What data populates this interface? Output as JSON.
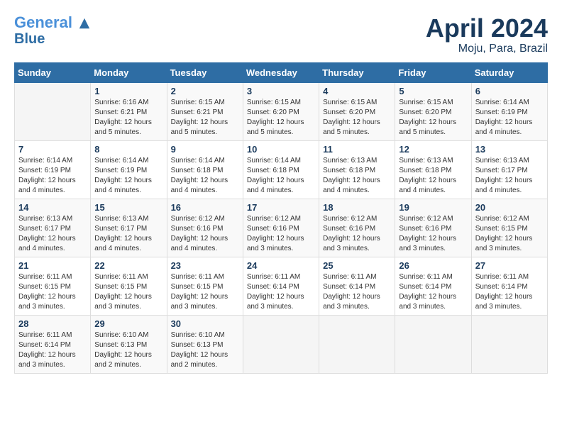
{
  "header": {
    "logo_line1": "General",
    "logo_line2": "Blue",
    "title": "April 2024",
    "subtitle": "Moju, Para, Brazil"
  },
  "columns": [
    "Sunday",
    "Monday",
    "Tuesday",
    "Wednesday",
    "Thursday",
    "Friday",
    "Saturday"
  ],
  "weeks": [
    [
      {
        "day": "",
        "info": ""
      },
      {
        "day": "1",
        "info": "Sunrise: 6:16 AM\nSunset: 6:21 PM\nDaylight: 12 hours\nand 5 minutes."
      },
      {
        "day": "2",
        "info": "Sunrise: 6:15 AM\nSunset: 6:21 PM\nDaylight: 12 hours\nand 5 minutes."
      },
      {
        "day": "3",
        "info": "Sunrise: 6:15 AM\nSunset: 6:20 PM\nDaylight: 12 hours\nand 5 minutes."
      },
      {
        "day": "4",
        "info": "Sunrise: 6:15 AM\nSunset: 6:20 PM\nDaylight: 12 hours\nand 5 minutes."
      },
      {
        "day": "5",
        "info": "Sunrise: 6:15 AM\nSunset: 6:20 PM\nDaylight: 12 hours\nand 5 minutes."
      },
      {
        "day": "6",
        "info": "Sunrise: 6:14 AM\nSunset: 6:19 PM\nDaylight: 12 hours\nand 4 minutes."
      }
    ],
    [
      {
        "day": "7",
        "info": "Sunrise: 6:14 AM\nSunset: 6:19 PM\nDaylight: 12 hours\nand 4 minutes."
      },
      {
        "day": "8",
        "info": "Sunrise: 6:14 AM\nSunset: 6:19 PM\nDaylight: 12 hours\nand 4 minutes."
      },
      {
        "day": "9",
        "info": "Sunrise: 6:14 AM\nSunset: 6:18 PM\nDaylight: 12 hours\nand 4 minutes."
      },
      {
        "day": "10",
        "info": "Sunrise: 6:14 AM\nSunset: 6:18 PM\nDaylight: 12 hours\nand 4 minutes."
      },
      {
        "day": "11",
        "info": "Sunrise: 6:13 AM\nSunset: 6:18 PM\nDaylight: 12 hours\nand 4 minutes."
      },
      {
        "day": "12",
        "info": "Sunrise: 6:13 AM\nSunset: 6:18 PM\nDaylight: 12 hours\nand 4 minutes."
      },
      {
        "day": "13",
        "info": "Sunrise: 6:13 AM\nSunset: 6:17 PM\nDaylight: 12 hours\nand 4 minutes."
      }
    ],
    [
      {
        "day": "14",
        "info": "Sunrise: 6:13 AM\nSunset: 6:17 PM\nDaylight: 12 hours\nand 4 minutes."
      },
      {
        "day": "15",
        "info": "Sunrise: 6:13 AM\nSunset: 6:17 PM\nDaylight: 12 hours\nand 4 minutes."
      },
      {
        "day": "16",
        "info": "Sunrise: 6:12 AM\nSunset: 6:16 PM\nDaylight: 12 hours\nand 4 minutes."
      },
      {
        "day": "17",
        "info": "Sunrise: 6:12 AM\nSunset: 6:16 PM\nDaylight: 12 hours\nand 3 minutes."
      },
      {
        "day": "18",
        "info": "Sunrise: 6:12 AM\nSunset: 6:16 PM\nDaylight: 12 hours\nand 3 minutes."
      },
      {
        "day": "19",
        "info": "Sunrise: 6:12 AM\nSunset: 6:16 PM\nDaylight: 12 hours\nand 3 minutes."
      },
      {
        "day": "20",
        "info": "Sunrise: 6:12 AM\nSunset: 6:15 PM\nDaylight: 12 hours\nand 3 minutes."
      }
    ],
    [
      {
        "day": "21",
        "info": "Sunrise: 6:11 AM\nSunset: 6:15 PM\nDaylight: 12 hours\nand 3 minutes."
      },
      {
        "day": "22",
        "info": "Sunrise: 6:11 AM\nSunset: 6:15 PM\nDaylight: 12 hours\nand 3 minutes."
      },
      {
        "day": "23",
        "info": "Sunrise: 6:11 AM\nSunset: 6:15 PM\nDaylight: 12 hours\nand 3 minutes."
      },
      {
        "day": "24",
        "info": "Sunrise: 6:11 AM\nSunset: 6:14 PM\nDaylight: 12 hours\nand 3 minutes."
      },
      {
        "day": "25",
        "info": "Sunrise: 6:11 AM\nSunset: 6:14 PM\nDaylight: 12 hours\nand 3 minutes."
      },
      {
        "day": "26",
        "info": "Sunrise: 6:11 AM\nSunset: 6:14 PM\nDaylight: 12 hours\nand 3 minutes."
      },
      {
        "day": "27",
        "info": "Sunrise: 6:11 AM\nSunset: 6:14 PM\nDaylight: 12 hours\nand 3 minutes."
      }
    ],
    [
      {
        "day": "28",
        "info": "Sunrise: 6:11 AM\nSunset: 6:14 PM\nDaylight: 12 hours\nand 3 minutes."
      },
      {
        "day": "29",
        "info": "Sunrise: 6:10 AM\nSunset: 6:13 PM\nDaylight: 12 hours\nand 2 minutes."
      },
      {
        "day": "30",
        "info": "Sunrise: 6:10 AM\nSunset: 6:13 PM\nDaylight: 12 hours\nand 2 minutes."
      },
      {
        "day": "",
        "info": ""
      },
      {
        "day": "",
        "info": ""
      },
      {
        "day": "",
        "info": ""
      },
      {
        "day": "",
        "info": ""
      }
    ]
  ]
}
